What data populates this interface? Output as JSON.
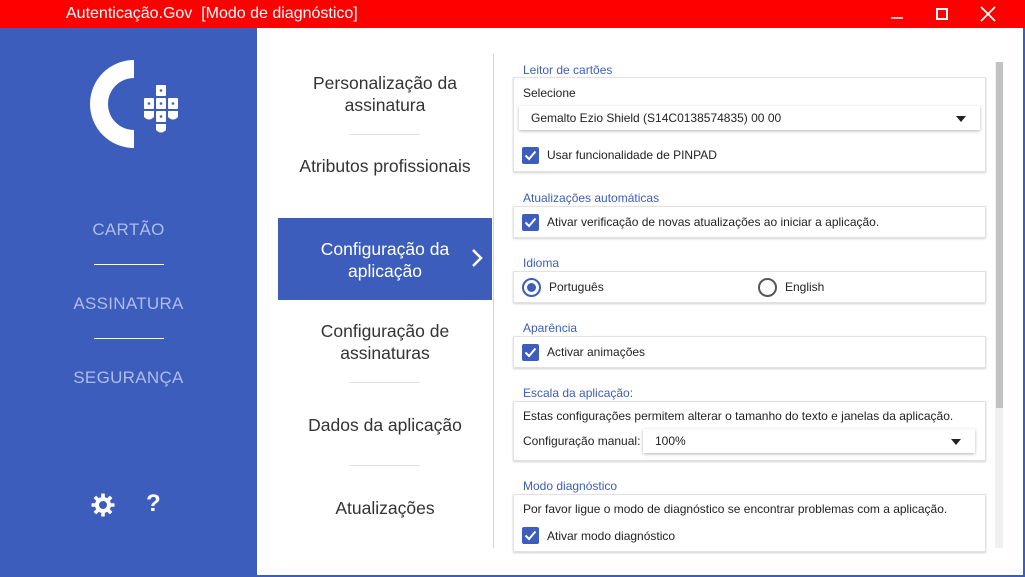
{
  "window": {
    "title": "Autenticação.Gov  [Modo de diagnóstico]",
    "minimize_glyph": "—",
    "maximize_glyph": "☐",
    "close_glyph": "✕",
    "title_bar_color": "#ff0000"
  },
  "theme": {
    "accent": "#3c5dbc"
  },
  "sidebar": {
    "items": [
      {
        "label": "CARTÃO"
      },
      {
        "label": "ASSINATURA"
      },
      {
        "label": "SEGURANÇA"
      }
    ],
    "settings_icon": "gear-icon",
    "help_icon": "question-icon",
    "help_glyph": "?"
  },
  "subnav": {
    "items": [
      {
        "label": "Personalização da assinatura"
      },
      {
        "label": "Atributos profissionais"
      },
      {
        "label": "Configuração da aplicação",
        "active": true
      },
      {
        "label": "Configuração de assinaturas"
      },
      {
        "label": "Dados da aplicação"
      },
      {
        "label": "Atualizações"
      }
    ]
  },
  "content": {
    "card_reader": {
      "title": "Leitor de cartões",
      "select_label": "Selecione",
      "selected_reader": "Gemalto Ezio Shield (S14C0138574835) 00 00",
      "pinpad_label": "Usar funcionalidade de PINPAD",
      "pinpad_checked": true
    },
    "auto_updates": {
      "title": "Atualizações automáticas",
      "check_label": "Ativar verificação de novas atualizações ao iniciar a aplicação.",
      "checked": true
    },
    "language": {
      "title": "Idioma",
      "option_pt": "Português",
      "option_en": "English",
      "selected": "Português"
    },
    "appearance": {
      "title": "Aparência",
      "animations_label": "Activar animações",
      "checked": true
    },
    "scale": {
      "title": "Escala da aplicação:",
      "description": "Estas configurações permitem alterar o tamanho do texto e janelas da aplicação.",
      "manual_label": "Configuração manual:",
      "manual_value": "100%"
    },
    "diagnostic": {
      "title": "Modo diagnóstico",
      "description": "Por favor ligue o modo de diagnóstico se encontrar problemas com a aplicação.",
      "toggle_label": "Ativar modo diagnóstico",
      "checked": true
    }
  }
}
